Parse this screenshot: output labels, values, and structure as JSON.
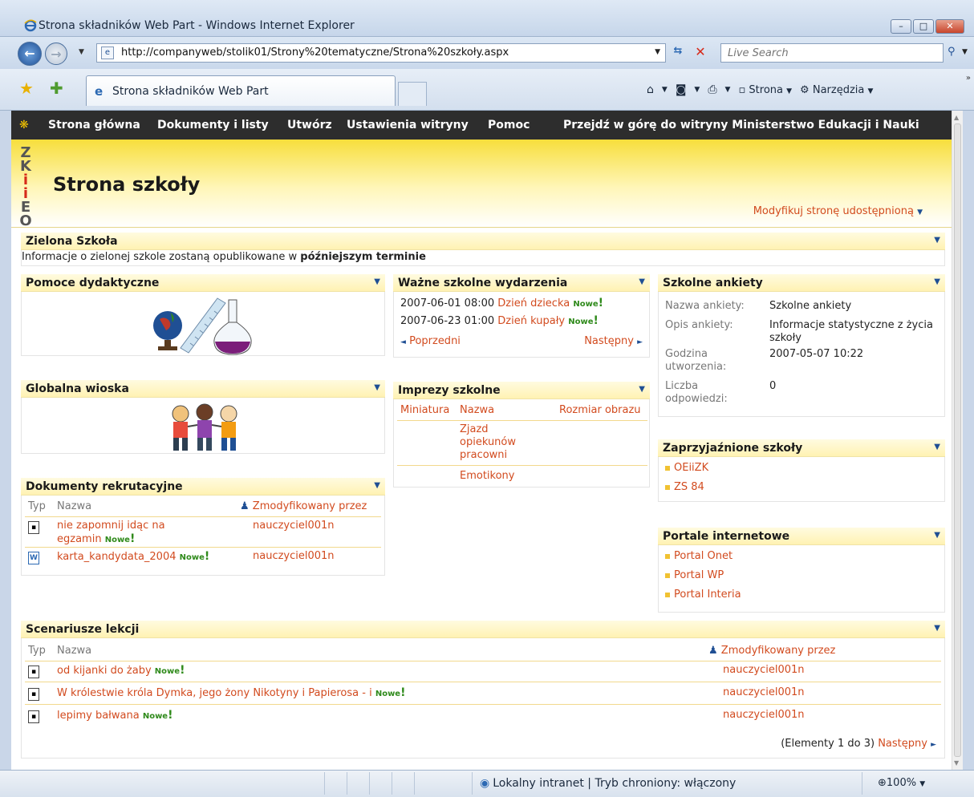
{
  "window": {
    "title": "Strona składników Web Part - Windows Internet Explorer",
    "minimize": "–",
    "maximize": "□",
    "close": "✕"
  },
  "address": {
    "url": "http://companyweb/stolik01/Strony%20tematyczne/Strona%20szkoły.aspx",
    "search_placeholder": "Live Search"
  },
  "tab": {
    "label": "Strona składników Web Part"
  },
  "command_bar": {
    "page_label": "Strona",
    "tools_label": "Narzędzia"
  },
  "site": {
    "topnav": [
      "Strona główna",
      "Dokumenty i listy",
      "Utwórz",
      "Ustawienia witryny",
      "Pomoc"
    ],
    "up_link": "Przejdź w górę do witryny Ministerstwo Edukacji i Nauki",
    "logo_letters": [
      "Z",
      "K",
      "i",
      "i",
      "E",
      "O"
    ],
    "title": "Strona szkoły",
    "modify_link": "Modyfikuj stronę udostępnioną"
  },
  "zielona": {
    "title": "Zielona Szkoła",
    "text_prefix": "Informacje o zielonej szkole zostaną opublikowane w ",
    "text_bold": "późniejszym terminie"
  },
  "pomoce": {
    "title": "Pomoce dydaktyczne"
  },
  "globalna": {
    "title": "Globalna wioska"
  },
  "dokumenty": {
    "title": "Dokumenty rekrutacyjne",
    "col_type": "Typ",
    "col_name": "Nazwa",
    "col_modified": "Zmodyfikowany przez",
    "rows": [
      {
        "name_line1": "nie zapomnij idąc na",
        "name_line2": "egzamin",
        "badge": "Nowe",
        "author": "nauczyciel001n"
      },
      {
        "name_line1": "karta_kandydata_2004",
        "name_line2": "",
        "badge": "Nowe",
        "author": "nauczyciel001n"
      }
    ]
  },
  "wydarzenia": {
    "title": "Ważne szkolne wydarzenia",
    "rows": [
      {
        "date": "2007-06-01 08:00",
        "name": "Dzień dziecka",
        "badge": "Nowe"
      },
      {
        "date": "2007-06-23 01:00",
        "name": "Dzień kupały",
        "badge": "Nowe"
      }
    ],
    "prev": "Poprzedni",
    "next": "Następny"
  },
  "imprezy": {
    "title": "Imprezy szkolne",
    "col_thumb": "Miniatura",
    "col_name": "Nazwa",
    "col_size": "Rozmiar obrazu",
    "rows": [
      {
        "name_lines": [
          "Zjazd",
          "opiekunów",
          "pracowni"
        ]
      },
      {
        "name_lines": [
          "Emotikony"
        ]
      }
    ]
  },
  "ankiety": {
    "title": "Szkolne ankiety",
    "fields": [
      {
        "label": "Nazwa ankiety:",
        "value": "Szkolne ankiety"
      },
      {
        "label": "Opis ankiety:",
        "value": "Informacje statystyczne z życia szkoły"
      },
      {
        "label": "Godzina utworzenia:",
        "value": "2007-05-07 10:22"
      },
      {
        "label": "Liczba odpowiedzi:",
        "value": "0"
      }
    ]
  },
  "zaprzyjaznione": {
    "title": "Zaprzyjaźnione szkoły",
    "items": [
      "OEiiZK",
      "ZS 84"
    ]
  },
  "portale": {
    "title": "Portale internetowe",
    "items": [
      "Portal Onet",
      "Portal WP",
      "Portal Interia"
    ]
  },
  "scenariusze": {
    "title": "Scenariusze lekcji",
    "col_type": "Typ",
    "col_name": "Nazwa",
    "col_modified": "Zmodyfikowany przez",
    "rows": [
      {
        "name": "od kijanki do żaby",
        "badge": "Nowe",
        "author": "nauczyciel001n"
      },
      {
        "name": "W królestwie króla Dymka, jego żony Nikotyny i Papierosa - i",
        "badge": "Nowe",
        "author": "nauczyciel001n"
      },
      {
        "name": "lepimy bałwana",
        "badge": "Nowe",
        "author": "nauczyciel001n"
      }
    ],
    "paging_text": "(Elementy 1 do 3)",
    "paging_next": "Następny"
  },
  "status": {
    "zone": "Lokalny intranet | Tryb chroniony: włączony",
    "zoom": "100%"
  },
  "colors": {
    "link": "#d24b1f",
    "new_badge": "#2f8a1b",
    "topnav_bg": "#2d2d2d",
    "banner_yellow": "#f7de3c"
  }
}
